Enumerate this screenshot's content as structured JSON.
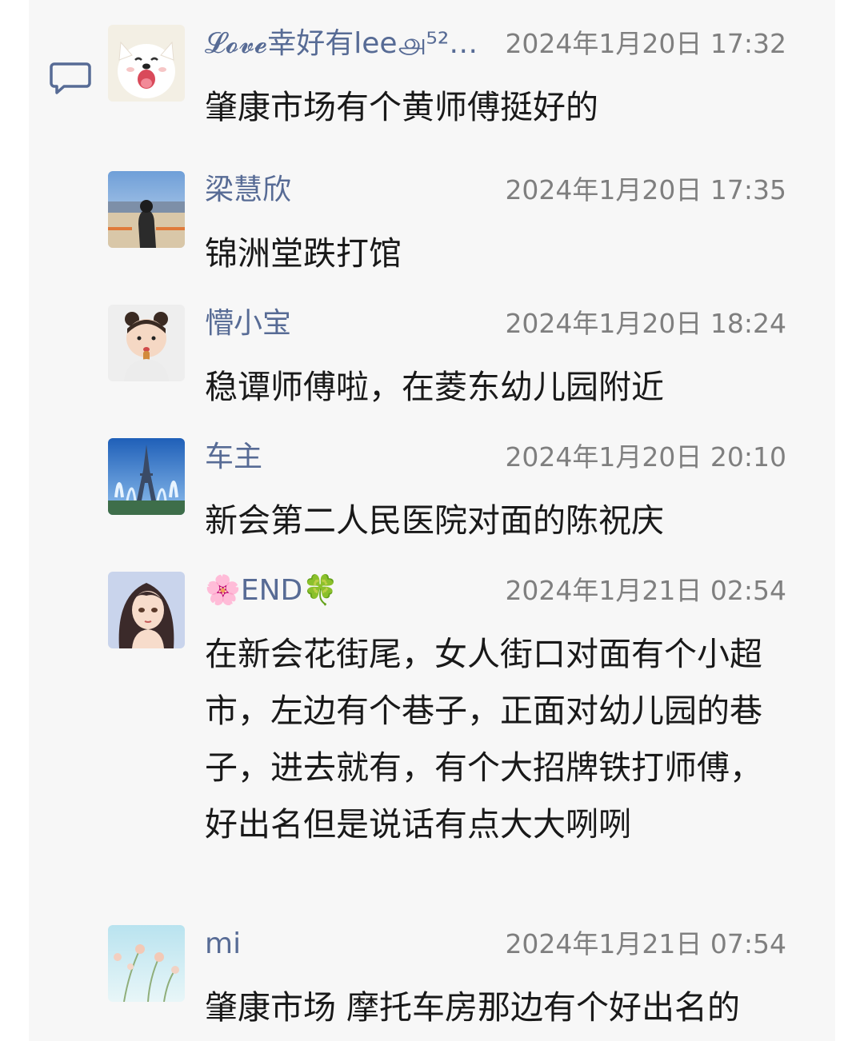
{
  "comments": [
    {
      "name": "𝓛𝓸𝓿𝓮幸好有lee௮⁵²…",
      "time": "2024年1月20日 17:32",
      "text": "肇康市场有个黄师傅挺好的",
      "avatar": "samoyed-dog-avatar"
    },
    {
      "name": "梁慧欣",
      "time": "2024年1月20日 17:35",
      "text": "锦洲堂跌打馆",
      "avatar": "girl-at-seaside-avatar"
    },
    {
      "name": "懵小宝",
      "time": "2024年1月20日 18:24",
      "text": "稳谭师傅啦，在菱东幼儿园附近",
      "avatar": "baby-eating-avatar"
    },
    {
      "name": "车主",
      "time": "2024年1月20日 20:10",
      "text": "新会第二人民医院对面的陈祝庆",
      "avatar": "eiffel-tower-fountain-avatar"
    },
    {
      "name": "🌸END🍀",
      "time": "2024年1月21日 02:54",
      "text": "在新会花街尾，女人街口对面有个小超市，左边有个巷子，正面对幼儿园的巷子，进去就有，有个大招牌铁打师傅，好出名但是说话有点大大咧咧",
      "avatar": "anime-girl-avatar"
    },
    {
      "name": "mi",
      "time": "2024年1月21日 07:54",
      "text": "肇康市场 摩托车房那边有个好出名的",
      "avatar": "flowers-sky-avatar"
    }
  ],
  "icons": {
    "comment": "comment-bubble-icon"
  },
  "colors": {
    "name": "#576b95",
    "time": "#7f7f7f",
    "text": "#191919",
    "panel": "#f7f7f7"
  }
}
